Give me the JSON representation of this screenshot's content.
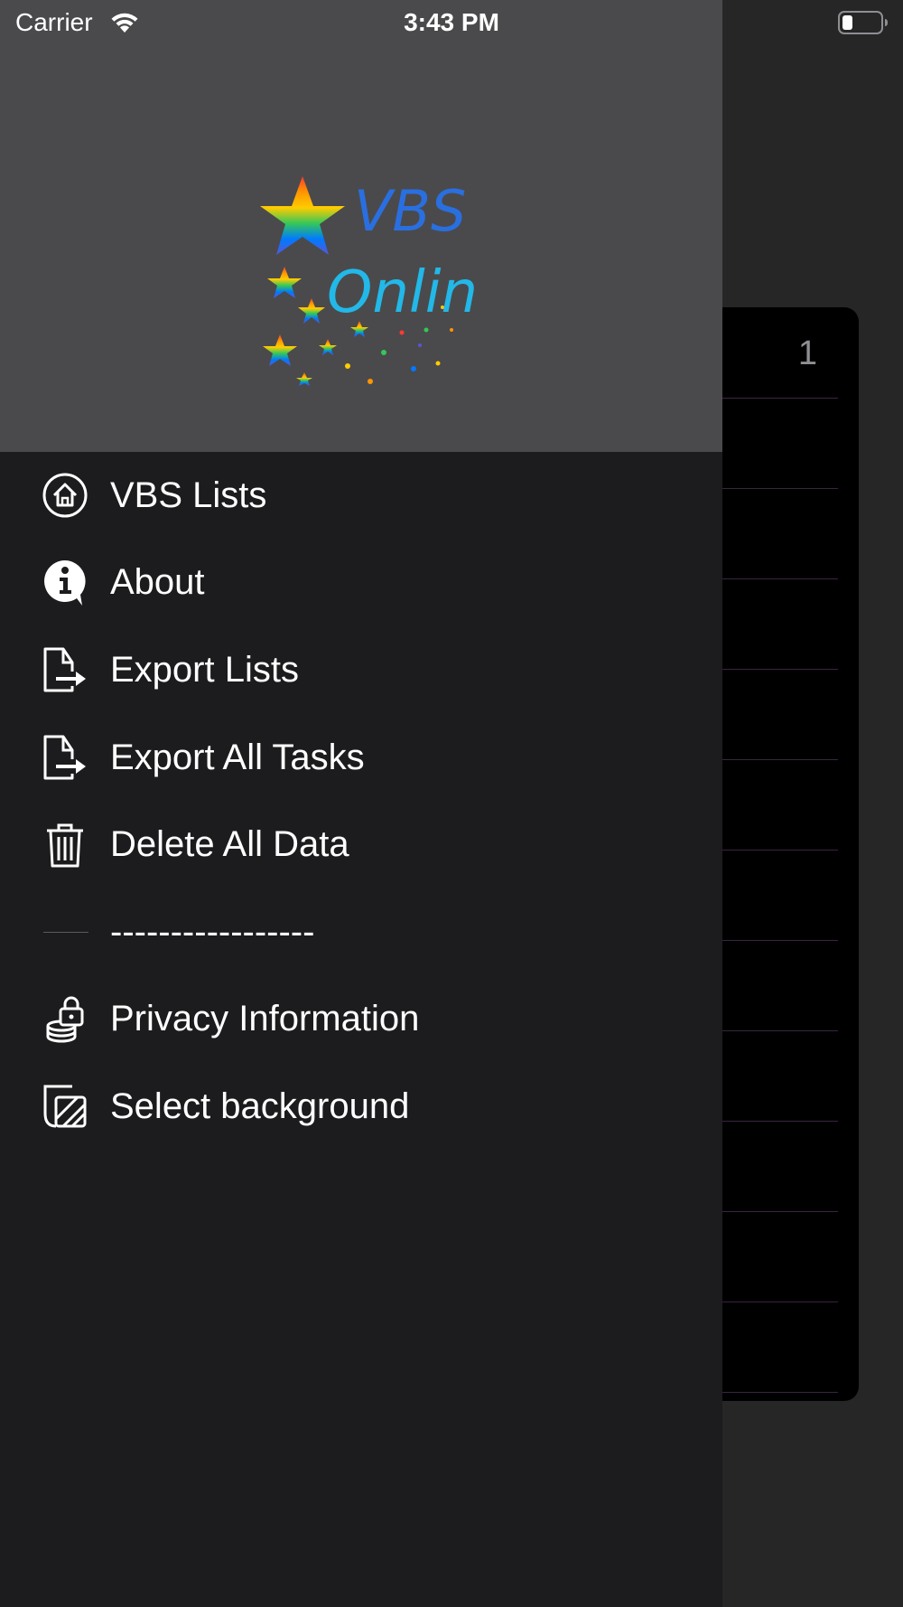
{
  "status_bar": {
    "carrier": "Carrier",
    "time": "3:43 PM"
  },
  "background_list": {
    "number": "1"
  },
  "drawer": {
    "logo": {
      "line1": "VBS",
      "line2": "Online"
    },
    "menu": [
      {
        "label": "VBS Lists",
        "icon": "home-icon"
      },
      {
        "label": "About",
        "icon": "info-icon"
      },
      {
        "label": "Export Lists",
        "icon": "export-file-icon"
      },
      {
        "label": "Export All Tasks",
        "icon": "export-file-icon"
      },
      {
        "label": "Delete All Data",
        "icon": "trash-icon"
      },
      {
        "label": "-----------------",
        "icon": "separator-line"
      },
      {
        "label": "Privacy Information",
        "icon": "privacy-lock-icon"
      },
      {
        "label": "Select background",
        "icon": "background-icon"
      }
    ]
  },
  "colors": {
    "drawer_bg": "#1c1c1e",
    "header_bg": "#4a4a4c",
    "page_bg": "#262626",
    "logo_blue": "#2a6fe0",
    "logo_cyan": "#22b8e8"
  }
}
